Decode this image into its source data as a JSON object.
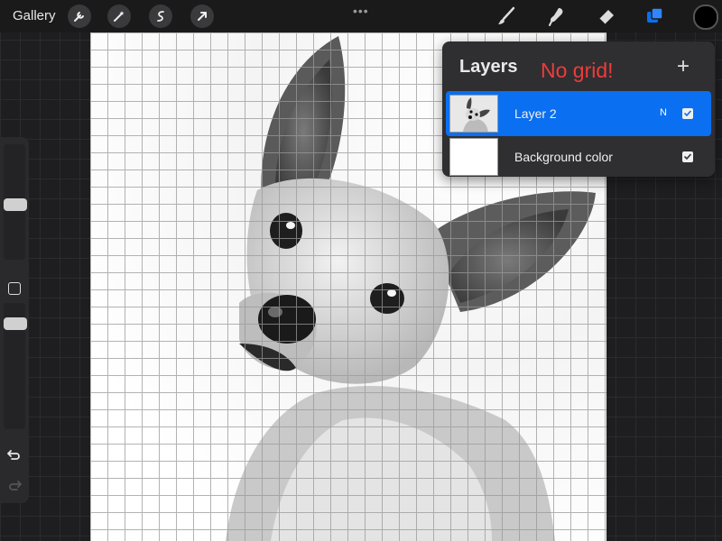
{
  "topbar": {
    "gallery_label": "Gallery",
    "actions_icon": "wrench-icon",
    "adjustments_icon": "magic-wand-icon",
    "selection_icon": "selection-s-icon",
    "transform_icon": "arrow-cursor-icon",
    "more_label": "•••",
    "brush_icon": "brush-icon",
    "smudge_icon": "smudge-icon",
    "eraser_icon": "eraser-icon",
    "layers_icon": "layers-icon",
    "current_color": "#000000",
    "accent_color": "#0a6ff0"
  },
  "layers_panel": {
    "title": "Layers",
    "annotation": "No grid!",
    "add_label": "+",
    "layers": [
      {
        "name": "Layer 2",
        "blend_mode": "N",
        "visible": true,
        "selected": true
      },
      {
        "name": "Background color",
        "visible": true,
        "selected": false
      }
    ]
  },
  "sidebar": {
    "brush_size_icon": "size-slider-icon",
    "opacity_icon": "opacity-slider-icon",
    "modify_icon": "modify-square-icon",
    "undo_icon": "undo-icon",
    "redo_icon": "redo-icon"
  },
  "canvas": {
    "content": "Layer 2",
    "guide": "drawing-grid"
  }
}
